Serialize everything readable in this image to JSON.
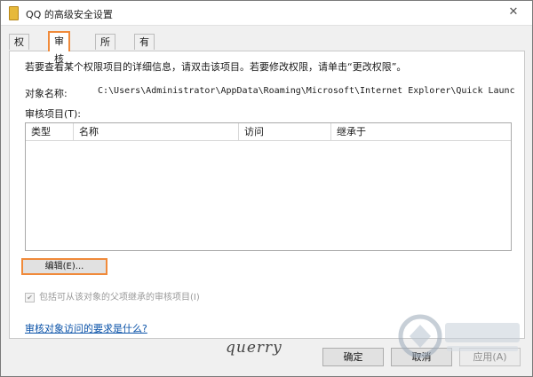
{
  "window": {
    "title": "QQ 的高级安全设置",
    "close_glyph": "✕"
  },
  "tabs": [
    {
      "label": "权限",
      "active": false
    },
    {
      "label": "审核",
      "active": true
    },
    {
      "label": "所有者",
      "active": false
    },
    {
      "label": "有效权限",
      "active": false
    }
  ],
  "panel": {
    "hint": "若要查看某个权限项目的详细信息，请双击该项目。若要修改权限，请单击“更改权限”。",
    "object_label": "对象名称:",
    "object_value": "C:\\Users\\Administrator\\AppData\\Roaming\\Microsoft\\Internet Explorer\\Quick Launch\\Use",
    "entries_label": "审核项目(T):",
    "columns": [
      "类型",
      "名称",
      "访问",
      "继承于"
    ],
    "rows": [],
    "edit_button": "编辑(E)...",
    "inherit_checkbox": "包括可从该对象的父项继承的审核项目(I)",
    "inherit_checked": true,
    "help_link": "审核对象访问的要求是什么?"
  },
  "footer": {
    "signature": "querry",
    "ok": "确定",
    "cancel": "取消",
    "apply": "应用(A)"
  },
  "colors": {
    "highlight": "#f08a3a",
    "link": "#0a52a8"
  },
  "icons": {
    "title_icon": "folder-icon",
    "close_icon": "close-icon",
    "checkbox_mark": "✔"
  }
}
